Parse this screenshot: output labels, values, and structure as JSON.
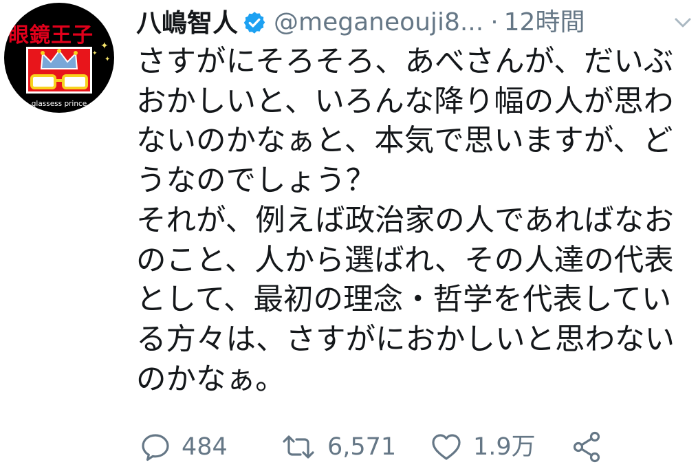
{
  "avatar": {
    "banner_text": "眼鏡王子",
    "caption": "glassess prince",
    "colors": {
      "background": "#000000",
      "banner": "#e0001b",
      "box": "#e8151b",
      "glasses": "#f7d31e",
      "crown": "#7aa7d8"
    }
  },
  "header": {
    "display_name": "八嶋智人",
    "handle": "@meganeouji8...",
    "separator": "·",
    "time": "12時間",
    "icons": {
      "verified": "verified-badge-icon",
      "menu": "chevron-down-icon"
    }
  },
  "tweet": {
    "lines": [
      "さすがにそろそろ、あべさんが、だいぶ",
      "おかしいと、いろんな降り幅の人が思わ",
      "ないのかなぁと、本気で思いますが、ど",
      "うなのでしょう？",
      "それが、例えば政治家の人であればなお",
      "のこと、人から選ばれ、その人達の代表",
      "として、最初の理念・哲学を代表してい",
      "る方々は、さすがにおかしいと思わない",
      "のかなぁ。"
    ]
  },
  "actions": {
    "reply": {
      "icon": "reply-icon",
      "count": "484"
    },
    "retweet": {
      "icon": "retweet-icon",
      "count": "6,571"
    },
    "like": {
      "icon": "heart-icon",
      "count": "1.9万"
    },
    "share": {
      "icon": "share-icon"
    }
  },
  "colors": {
    "text": "#14171a",
    "secondary": "#657786",
    "verified": "#1da1f2"
  }
}
